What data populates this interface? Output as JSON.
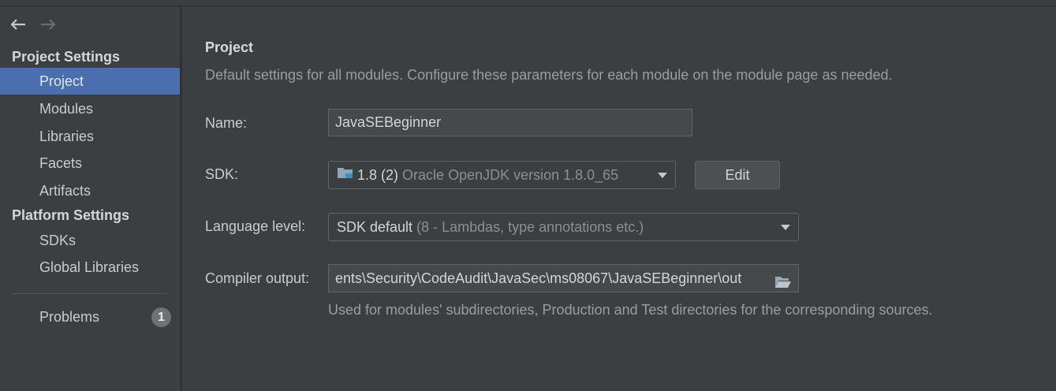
{
  "sidebar": {
    "project_settings_title": "Project Settings",
    "project_settings_items": [
      {
        "label": "Project",
        "selected": true
      },
      {
        "label": "Modules"
      },
      {
        "label": "Libraries"
      },
      {
        "label": "Facets"
      },
      {
        "label": "Artifacts"
      }
    ],
    "platform_settings_title": "Platform Settings",
    "platform_settings_items": [
      {
        "label": "SDKs"
      },
      {
        "label": "Global Libraries"
      }
    ],
    "problems": {
      "label": "Problems",
      "count": "1"
    }
  },
  "main": {
    "title": "Project",
    "description": "Default settings for all modules. Configure these parameters for each module on the module page as needed.",
    "name": {
      "label": "Name:",
      "value": "JavaSEBeginner"
    },
    "sdk": {
      "label": "SDK:",
      "value": "1.8 (2)",
      "detail": "Oracle OpenJDK version 1.8.0_65",
      "edit_label": "Edit"
    },
    "language_level": {
      "label": "Language level:",
      "value": "SDK default",
      "detail": "(8 - Lambdas, type annotations etc.)"
    },
    "compiler_output": {
      "label": "Compiler output:",
      "value": "ents\\Security\\CodeAudit\\JavaSec\\ms08067\\JavaSEBeginner\\out"
    },
    "compiler_hint": "Used for modules' subdirectories, Production and Test directories for the corresponding sources."
  },
  "icons": {
    "back": "arrow-left-icon",
    "forward": "arrow-right-icon",
    "sdk": "jdk-folder-icon",
    "browse": "folder-open-icon"
  },
  "colors": {
    "background": "#3c3f41",
    "selection": "#4b6eaf"
  }
}
